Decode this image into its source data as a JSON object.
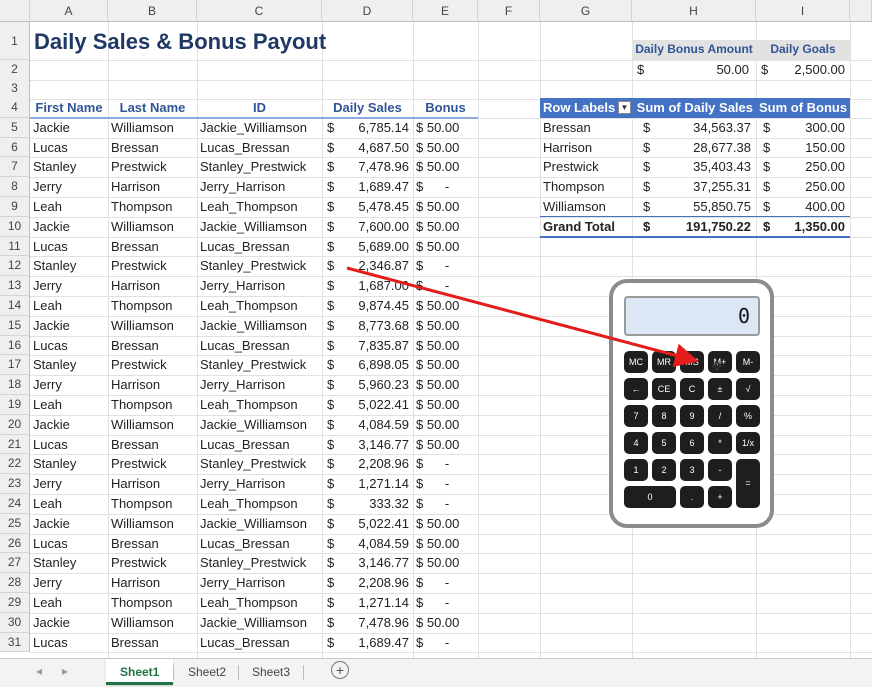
{
  "columns": [
    "A",
    "B",
    "C",
    "D",
    "E",
    "F",
    "G",
    "H",
    "I"
  ],
  "row_numbers": [
    "1",
    "2",
    "3",
    "4",
    "5",
    "6",
    "7",
    "8",
    "9",
    "10",
    "11",
    "12",
    "13",
    "14",
    "15",
    "16",
    "17",
    "18",
    "19",
    "20",
    "21",
    "22",
    "23",
    "24",
    "25",
    "26",
    "27",
    "28",
    "29",
    "30",
    "31"
  ],
  "title": "Daily Sales & Bonus Payout",
  "top_right": {
    "h1": "Daily Bonus Amount",
    "i1": "Daily Goals",
    "h2_currency": "$",
    "h2_value": "50.00",
    "i2_currency": "$",
    "i2_value": "2,500.00"
  },
  "table_headers": [
    "First Name",
    "Last Name",
    "ID",
    "Daily Sales",
    "Bonus"
  ],
  "rows": [
    [
      "Jackie",
      "Williamson",
      "Jackie_Williamson",
      "$",
      "6,785.14",
      "$ 50.00"
    ],
    [
      "Lucas",
      "Bressan",
      "Lucas_Bressan",
      "$",
      "4,687.50",
      "$ 50.00"
    ],
    [
      "Stanley",
      "Prestwick",
      "Stanley_Prestwick",
      "$",
      "7,478.96",
      "$ 50.00"
    ],
    [
      "Jerry",
      "Harrison",
      "Jerry_Harrison",
      "$",
      "1,689.47",
      "$      -"
    ],
    [
      "Leah",
      "Thompson",
      "Leah_Thompson",
      "$",
      "5,478.45",
      "$ 50.00"
    ],
    [
      "Jackie",
      "Williamson",
      "Jackie_Williamson",
      "$",
      "7,600.00",
      "$ 50.00"
    ],
    [
      "Lucas",
      "Bressan",
      "Lucas_Bressan",
      "$",
      "5,689.00",
      "$ 50.00"
    ],
    [
      "Stanley",
      "Prestwick",
      "Stanley_Prestwick",
      "$",
      "2,346.87",
      "$      -"
    ],
    [
      "Jerry",
      "Harrison",
      "Jerry_Harrison",
      "$",
      "1,687.00",
      "$      -"
    ],
    [
      "Leah",
      "Thompson",
      "Leah_Thompson",
      "$",
      "9,874.45",
      "$ 50.00"
    ],
    [
      "Jackie",
      "Williamson",
      "Jackie_Williamson",
      "$",
      "8,773.68",
      "$ 50.00"
    ],
    [
      "Lucas",
      "Bressan",
      "Lucas_Bressan",
      "$",
      "7,835.87",
      "$ 50.00"
    ],
    [
      "Stanley",
      "Prestwick",
      "Stanley_Prestwick",
      "$",
      "6,898.05",
      "$ 50.00"
    ],
    [
      "Jerry",
      "Harrison",
      "Jerry_Harrison",
      "$",
      "5,960.23",
      "$ 50.00"
    ],
    [
      "Leah",
      "Thompson",
      "Leah_Thompson",
      "$",
      "5,022.41",
      "$ 50.00"
    ],
    [
      "Jackie",
      "Williamson",
      "Jackie_Williamson",
      "$",
      "4,084.59",
      "$ 50.00"
    ],
    [
      "Lucas",
      "Bressan",
      "Lucas_Bressan",
      "$",
      "3,146.77",
      "$ 50.00"
    ],
    [
      "Stanley",
      "Prestwick",
      "Stanley_Prestwick",
      "$",
      "2,208.96",
      "$      -"
    ],
    [
      "Jerry",
      "Harrison",
      "Jerry_Harrison",
      "$",
      "1,271.14",
      "$      -"
    ],
    [
      "Leah",
      "Thompson",
      "Leah_Thompson",
      "$",
      "333.32",
      "$      -"
    ],
    [
      "Jackie",
      "Williamson",
      "Jackie_Williamson",
      "$",
      "5,022.41",
      "$ 50.00"
    ],
    [
      "Lucas",
      "Bressan",
      "Lucas_Bressan",
      "$",
      "4,084.59",
      "$ 50.00"
    ],
    [
      "Stanley",
      "Prestwick",
      "Stanley_Prestwick",
      "$",
      "3,146.77",
      "$ 50.00"
    ],
    [
      "Jerry",
      "Harrison",
      "Jerry_Harrison",
      "$",
      "2,208.96",
      "$      -"
    ],
    [
      "Leah",
      "Thompson",
      "Leah_Thompson",
      "$",
      "1,271.14",
      "$      -"
    ],
    [
      "Jackie",
      "Williamson",
      "Jackie_Williamson",
      "$",
      "7,478.96",
      "$ 50.00"
    ],
    [
      "Lucas",
      "Bressan",
      "Lucas_Bressan",
      "$",
      "1,689.47",
      "$      -"
    ]
  ],
  "pivot": {
    "headers": [
      "Row Labels",
      "Sum of Daily Sales",
      "Sum of Bonus"
    ],
    "rows": [
      [
        "Bressan",
        "$",
        "34,563.37",
        "$",
        "300.00"
      ],
      [
        "Harrison",
        "$",
        "28,677.38",
        "$",
        "150.00"
      ],
      [
        "Prestwick",
        "$",
        "35,403.43",
        "$",
        "250.00"
      ],
      [
        "Thompson",
        "$",
        "37,255.31",
        "$",
        "250.00"
      ],
      [
        "Williamson",
        "$",
        "55,850.75",
        "$",
        "400.00"
      ]
    ],
    "total": [
      "Grand Total",
      "$",
      "191,750.22",
      "$",
      "1,350.00"
    ],
    "header_bg": "#4472c4"
  },
  "calculator": {
    "display": "0",
    "keys": [
      "MC",
      "MR",
      "MS",
      "M+",
      "M-",
      "←",
      "CE",
      "C",
      "±",
      "√",
      "7",
      "8",
      "9",
      "/",
      "%",
      "4",
      "5",
      "6",
      "*",
      "1/x",
      "1",
      "2",
      "3",
      "-",
      "=",
      "0",
      ".",
      "+"
    ]
  },
  "arrow_color": "#e31c1c",
  "tabs": [
    "Sheet1",
    "Sheet2",
    "Sheet3"
  ],
  "add_sheet_icon": "plus-circle-icon",
  "nav_icons": [
    "chevron-left-icon",
    "chevron-right-icon"
  ]
}
